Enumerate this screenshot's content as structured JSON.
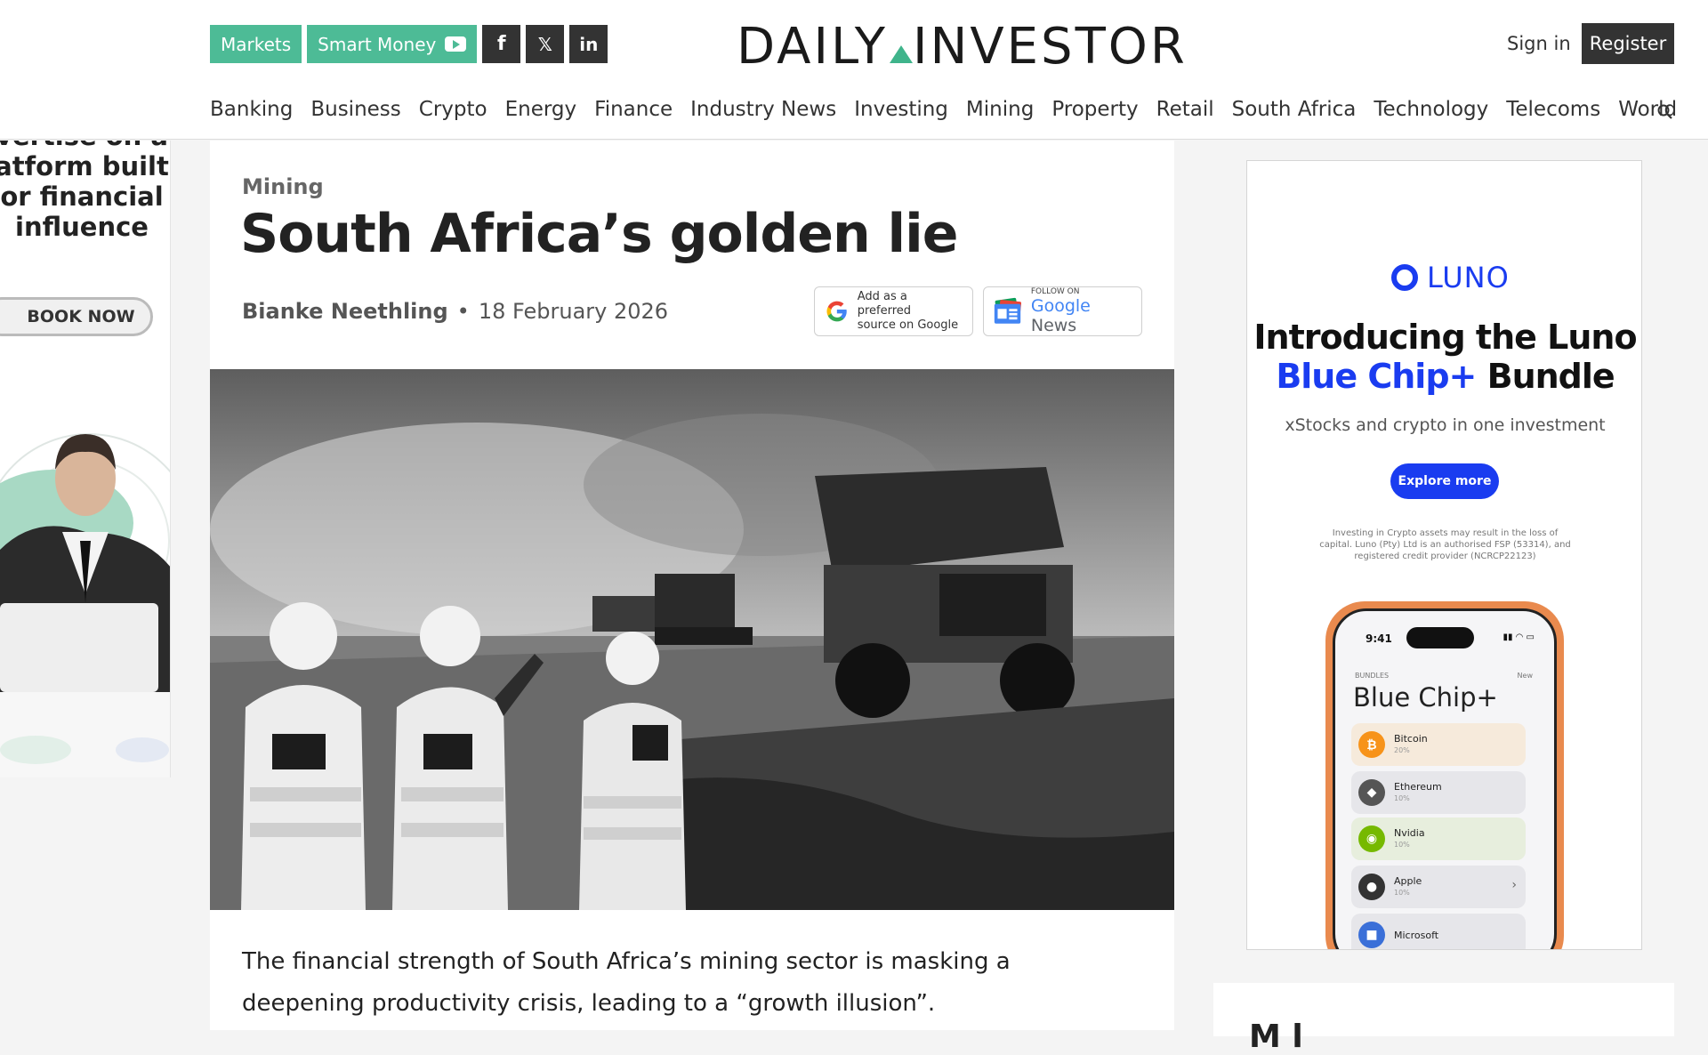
{
  "header": {
    "pills": [
      {
        "label": "Markets"
      },
      {
        "label": "Smart Money"
      }
    ],
    "social": [
      "f",
      "𝕏",
      "in"
    ],
    "logo_left": "DAILY",
    "logo_right": "INVESTOR",
    "sign_in": "Sign in",
    "register": "Register",
    "nav": [
      "Banking",
      "Business",
      "Crypto",
      "Energy",
      "Finance",
      "Industry News",
      "Investing",
      "Mining",
      "Property",
      "Retail",
      "South Africa",
      "Technology",
      "Telecoms",
      "World"
    ]
  },
  "left_ad": {
    "text_lines": [
      "vertise on a",
      "atform built",
      "or financial",
      "influence"
    ],
    "book_now": "BOOK NOW"
  },
  "article": {
    "category": "Mining",
    "title": "South Africa’s golden lie",
    "author": "Bianke Neethling",
    "date": "18 February 2026",
    "google_pref_line1": "Add as a preferred",
    "google_pref_line2": "source on Google",
    "follow_on": "FOLLOW ON",
    "google": "Google",
    "news": "News",
    "lede": "The financial strength of South Africa’s mining sector is masking a deepening productivity crisis, leading to a “growth illusion”."
  },
  "right_ad": {
    "brand": "LUNO",
    "headline_line1": "Introducing the Luno",
    "headline_blue": "Blue Chip+",
    "headline_rest": " Bundle",
    "sub": "xStocks and crypto in one investment",
    "cta": "Explore more",
    "disclaimer": "Investing in Crypto assets may result in the loss of capital. Luno (Pty) Ltd is an authorised FSP (53314), and registered credit provider (NCRCP22123)",
    "phone": {
      "time": "9:41",
      "bundles": "BUNDLES",
      "new": "New",
      "title": "Blue Chip+",
      "assets": [
        {
          "name": "Bitcoin",
          "pct": "20%",
          "color": "#f7931a",
          "glyph": "₿",
          "bg": "#f6eadb"
        },
        {
          "name": "Ethereum",
          "pct": "10%",
          "color": "#555555",
          "glyph": "◆",
          "bg": "#e6e6ea"
        },
        {
          "name": "Nvidia",
          "pct": "10%",
          "color": "#76b900",
          "glyph": "◉",
          "bg": "#e7eedd"
        },
        {
          "name": "Apple",
          "pct": "10%",
          "color": "#333333",
          "glyph": "",
          "bg": "#e6e6ea"
        },
        {
          "name": "Microsoft",
          "pct": "",
          "color": "#3a6fd8",
          "glyph": "■",
          "bg": "#e6e6ea"
        }
      ]
    }
  },
  "bottom_right": {
    "peek": "M    l"
  },
  "colors": {
    "accent_green": "#4dbb96",
    "luno_blue": "#1a3cf0",
    "dark": "#333333"
  }
}
